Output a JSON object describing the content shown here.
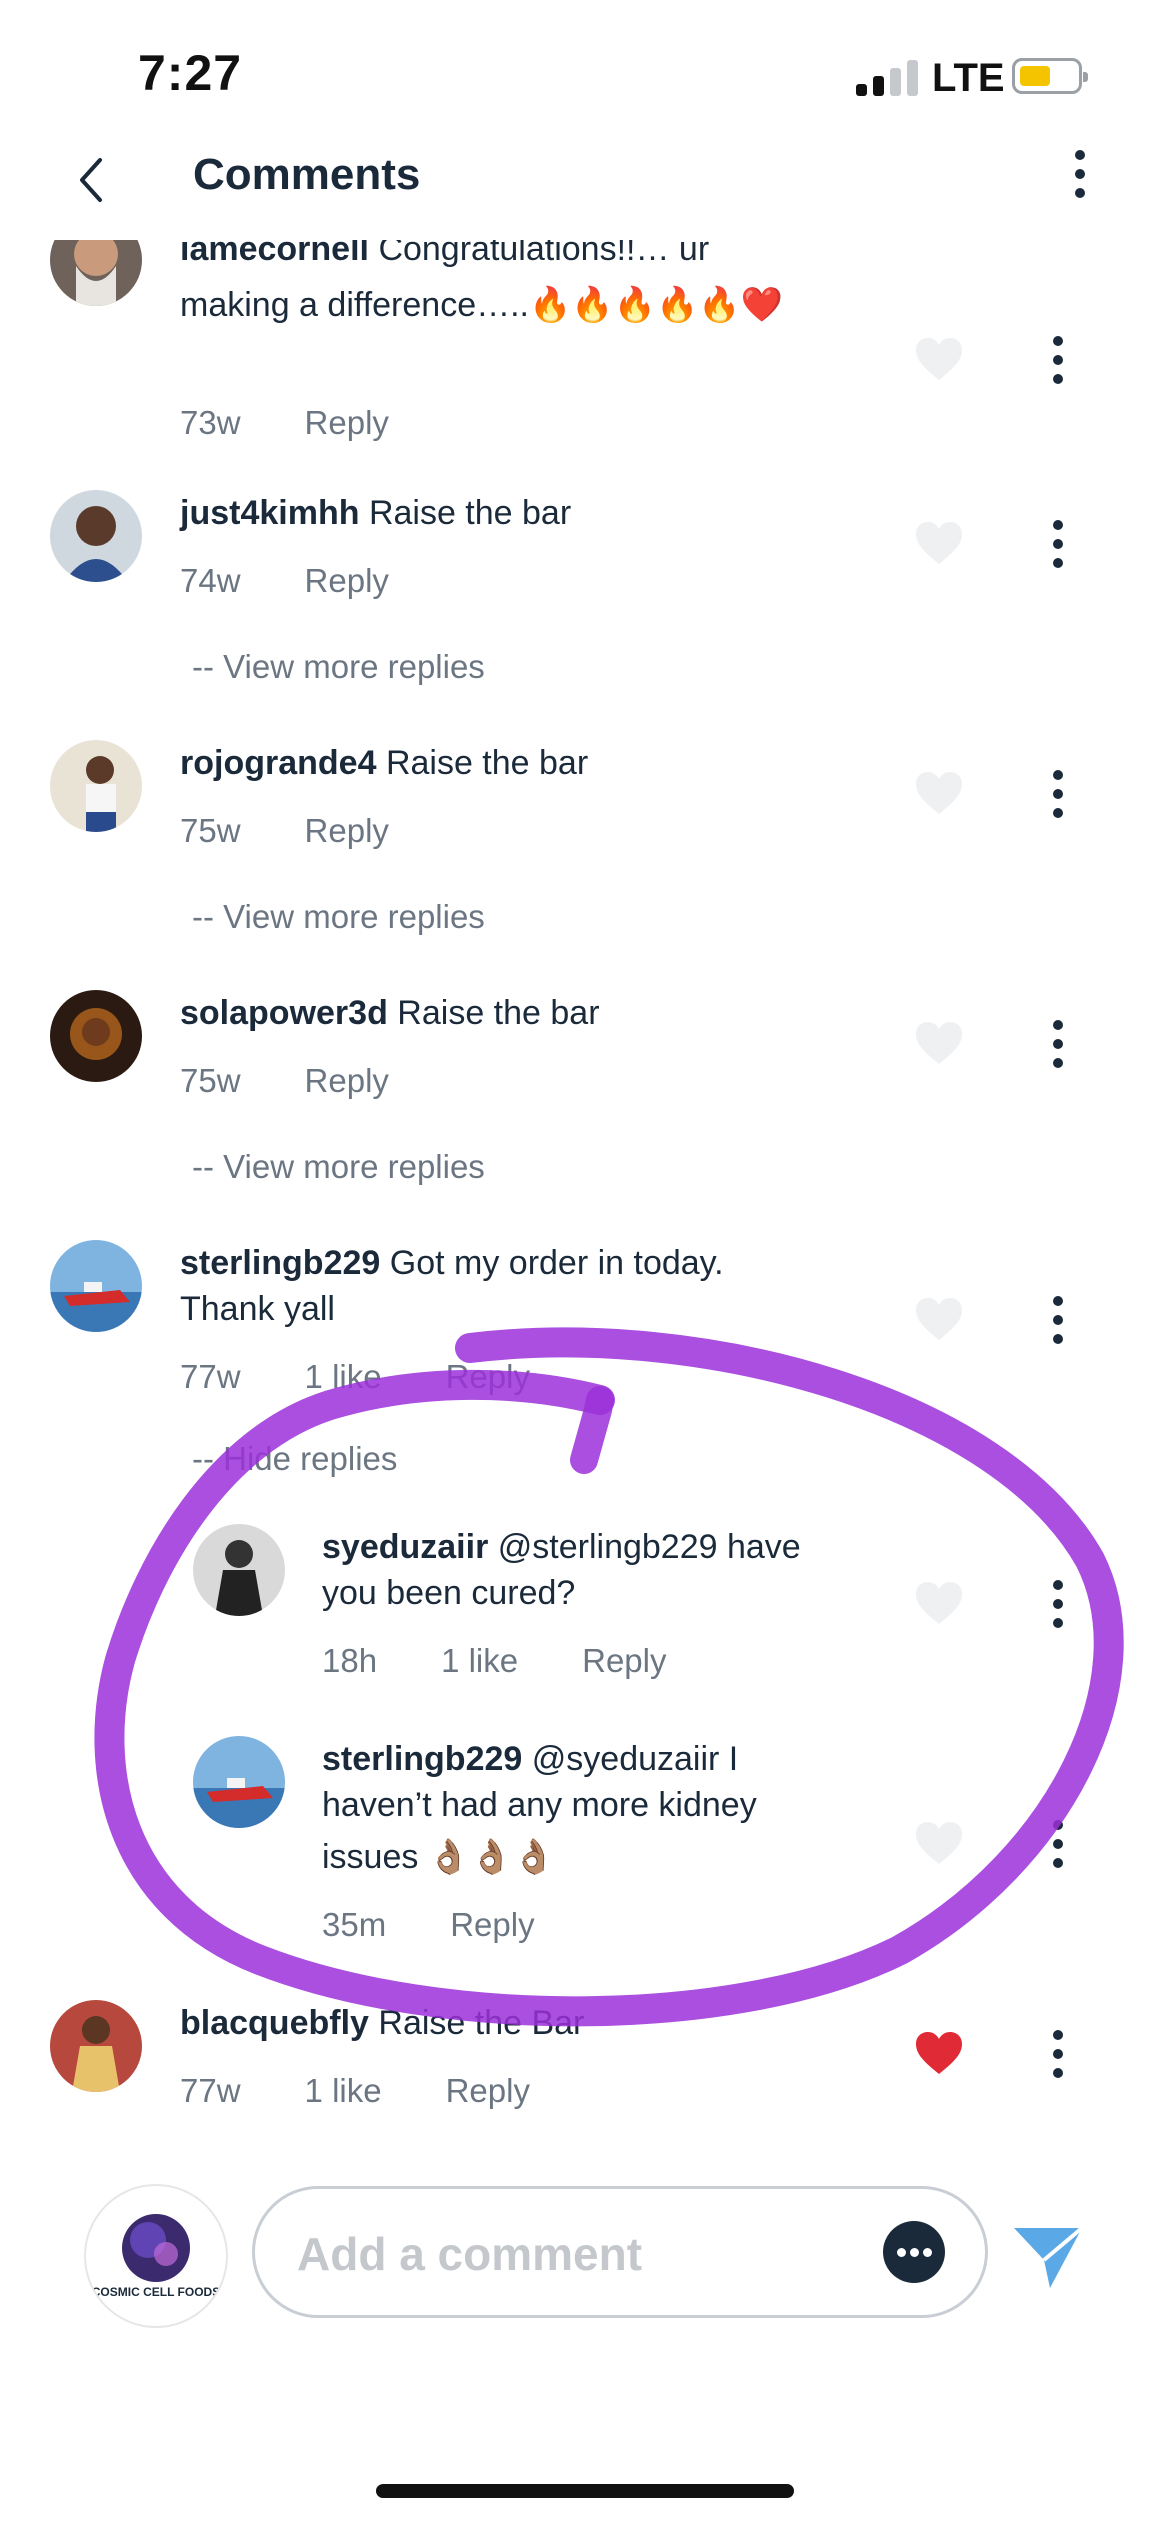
{
  "status_bar": {
    "time": "7:27",
    "network": "LTE"
  },
  "header": {
    "title": "Comments",
    "back_icon": "chevron-left-icon",
    "menu_icon": "more-vertical-icon"
  },
  "comments": [
    {
      "username": "iamecornell",
      "text": "Congratulations!!… ur",
      "text2": "making a difference…..🔥🔥🔥🔥🔥❤️",
      "age": "73w",
      "reply": "Reply",
      "liked": false
    },
    {
      "username": "just4kimhh",
      "text": "Raise the bar",
      "age": "74w",
      "reply": "Reply",
      "view_more": "-- View more replies",
      "liked": false
    },
    {
      "username": "rojogrande4",
      "text": "Raise the bar",
      "age": "75w",
      "reply": "Reply",
      "view_more": "-- View more replies",
      "liked": false
    },
    {
      "username": "solapower3d",
      "text": "Raise the bar",
      "age": "75w",
      "reply": "Reply",
      "view_more": "-- View more replies",
      "liked": false
    },
    {
      "username": "sterlingb229",
      "text": "Got my order in today.",
      "text2": "Thank yall",
      "age": "77w",
      "likes": "1 like",
      "reply": "Reply",
      "hide_replies": "-- Hide replies",
      "liked": false,
      "replies": [
        {
          "username": "syeduzaiir",
          "text": "@sterlingb229 have",
          "text2": "you been cured?",
          "age": "18h",
          "likes": "1 like",
          "reply": "Reply",
          "liked": false
        },
        {
          "username": "sterlingb229",
          "text": "@syeduzaiir I",
          "text2": "haven’t had any more kidney",
          "text3": "issues 👌🏽👌🏽👌🏽",
          "age": "35m",
          "reply": "Reply",
          "liked": false
        }
      ]
    },
    {
      "username": "blacquebfly",
      "text": "Raise the Bar",
      "age": "77w",
      "likes": "1 like",
      "reply": "Reply",
      "liked": true
    }
  ],
  "composer": {
    "placeholder": "Add a comment",
    "avatar_label": "COSMIC CELL FOODS",
    "emoji_icon": "chat-bubble-icon",
    "send_icon": "send-icon"
  },
  "colors": {
    "text": "#1b2a3a",
    "meta": "#6b7682",
    "liked_heart": "#e02a35",
    "send": "#5aa9e6",
    "annotation": "#9b30d9",
    "battery": "#f4c400"
  }
}
